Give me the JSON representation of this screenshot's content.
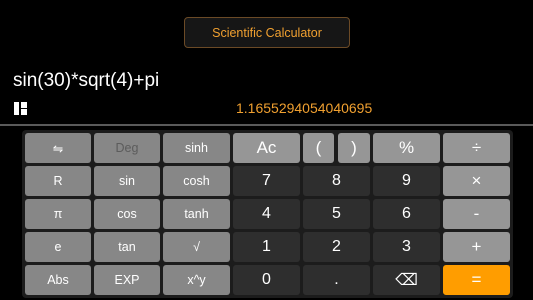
{
  "header": {
    "title": "Scientific Calculator"
  },
  "display": {
    "expression": "sin(30)*sqrt(4)+pi",
    "result": "1.1655294054040695"
  },
  "keys": {
    "swap": "⇋",
    "deg": "Deg",
    "sinh": "sinh",
    "ac": "Ac",
    "paren_open": "(",
    "paren_close": ")",
    "percent": "%",
    "divide": "÷",
    "r": "R",
    "sin": "sin",
    "cosh": "cosh",
    "seven": "7",
    "eight": "8",
    "nine": "9",
    "multiply": "×",
    "pi": "π",
    "cos": "cos",
    "tanh": "tanh",
    "four": "4",
    "five": "5",
    "six": "6",
    "subtract": "-",
    "e": "e",
    "tan": "tan",
    "sqrt": "√",
    "one": "1",
    "two": "2",
    "three": "3",
    "add": "+",
    "abs": "Abs",
    "exp": "EXP",
    "power": "x^y",
    "zero": "0",
    "dot": ".",
    "backspace": "⌫",
    "equals": "="
  },
  "colors": {
    "accent": "#ff9d00",
    "result_text": "#f0a030",
    "scientific_key": "#878787",
    "operator_key": "#969696",
    "number_key": "#2e2e2e"
  }
}
